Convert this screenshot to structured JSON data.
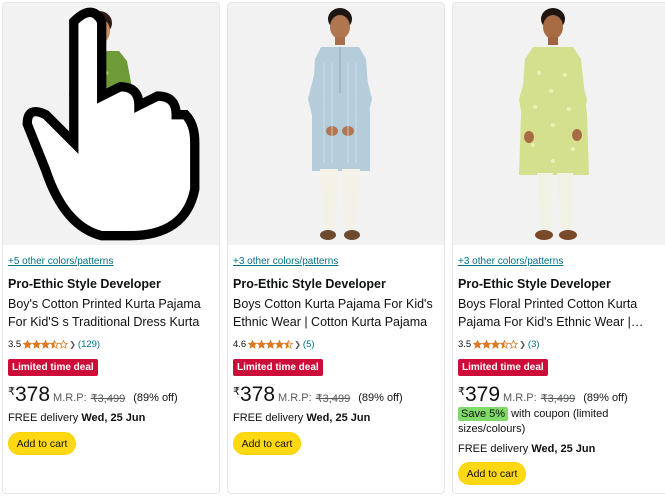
{
  "products": [
    {
      "colors_link": "+5 other colors/patterns",
      "brand": "Pro-Ethic Style Developer",
      "title": "Boy's Cotton Printed Kurta Pajama For Kid'S s Traditional Dress Kurta Pajama Set",
      "title_display": "Boy's Cotton Printed Kurta Pajama For Kid'S s Traditional Dress Kurta Paja…",
      "rating": "3.5",
      "stars_value": 3.5,
      "review_count": "(129)",
      "deal_badge": "Limited time deal",
      "currency": "₹",
      "price": "378",
      "mrp_label": "M.R.P:",
      "mrp": "₹3,499",
      "discount": "(89% off)",
      "delivery_prefix": "FREE delivery",
      "delivery_date": "Wed, 25 Jun",
      "cart_label": "Add to cart",
      "kurta_color": "#6e9a38"
    },
    {
      "colors_link": "+3 other colors/patterns",
      "brand": "Pro-Ethic Style Developer",
      "title": "Boys Cotton Kurta Pajama For Kid's Ethnic Wear | Cotton Kurta Pajama for Boys",
      "title_display": "Boys Cotton Kurta Pajama For Kid's Ethnic Wear | Cotton Kurta Pajama f…",
      "rating": "4.6",
      "stars_value": 4.5,
      "review_count": "(5)",
      "deal_badge": "Limited time deal",
      "currency": "₹",
      "price": "378",
      "mrp_label": "M.R.P:",
      "mrp": "₹3,499",
      "discount": "(89% off)",
      "delivery_prefix": "FREE delivery",
      "delivery_date": "Wed, 25 Jun",
      "cart_label": "Add to cart",
      "kurta_color": "#b5ccda"
    },
    {
      "colors_link": "+3 other colors/patterns",
      "brand": "Pro-Ethic Style Developer",
      "title": "Boys Floral Printed Cotton Kurta Pajama For Kid's Ethnic Wear | Cotton Kurta Pajama",
      "title_display": "Boys Floral Printed Cotton Kurta Pajama For Kid's Ethnic Wear |…",
      "rating": "3.5",
      "stars_value": 3.5,
      "review_count": "(3)",
      "deal_badge": "Limited time deal",
      "currency": "₹",
      "price": "379",
      "mrp_label": "M.R.P:",
      "mrp": "₹3,499",
      "discount": "(89% off)",
      "coupon_tag": "Save 5%",
      "coupon_text": "with coupon (limited sizes/colours)",
      "delivery_prefix": "FREE delivery",
      "delivery_date": "Wed, 25 Jun",
      "cart_label": "Add to cart",
      "kurta_color": "#d4e08e"
    }
  ],
  "colors": {
    "deal_red": "#cc0c39",
    "cart_yellow": "#ffd814",
    "link_teal": "#007185",
    "star_orange": "#de7921",
    "coupon_green": "#7fda69"
  }
}
